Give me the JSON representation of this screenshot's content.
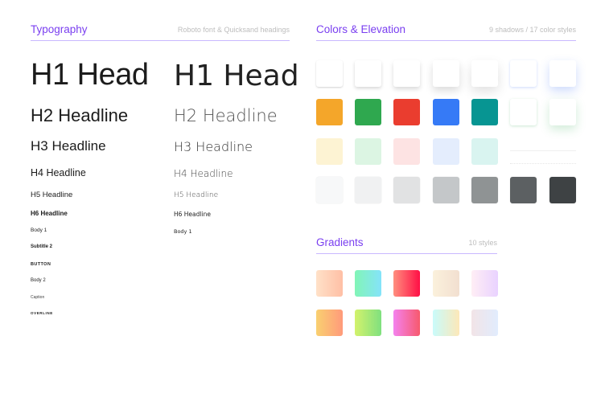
{
  "typography": {
    "title": "Typography",
    "meta": "Roboto font & Quicksand headings",
    "roboto": [
      {
        "style": "h1",
        "label": "H1 Head"
      },
      {
        "style": "h2",
        "label": "H2 Headline"
      },
      {
        "style": "h3",
        "label": "H3 Headline"
      },
      {
        "style": "h4",
        "label": "H4 Headline"
      },
      {
        "style": "h5",
        "label": "H5 Headline"
      },
      {
        "style": "h6",
        "label": "H6 Headline"
      },
      {
        "style": "body1",
        "label": "Body 1"
      },
      {
        "style": "sub2",
        "label": "Subtitle 2"
      },
      {
        "style": "button",
        "label": "BUTTON"
      },
      {
        "style": "body2",
        "label": "Body 2"
      },
      {
        "style": "caption",
        "label": "Caption"
      },
      {
        "style": "overline",
        "label": "OVERLINE"
      }
    ],
    "quicksand": [
      {
        "style": "h1",
        "label": "H1 Head"
      },
      {
        "style": "h2",
        "label": "H2 Headline"
      },
      {
        "style": "h3",
        "label": "H3 Headline"
      },
      {
        "style": "h4",
        "label": "H4 Headline"
      },
      {
        "style": "h5",
        "label": "H5 Headline"
      },
      {
        "style": "h6",
        "label": "H6 Headline"
      },
      {
        "style": "body1",
        "label": "Body 1"
      }
    ]
  },
  "colors": {
    "title": "Colors & Elevation",
    "meta": "9 shadows / 17 color styles",
    "shadows": [
      {
        "name": "elevation-1"
      },
      {
        "name": "elevation-2"
      },
      {
        "name": "elevation-3"
      },
      {
        "name": "elevation-4"
      },
      {
        "name": "elevation-5"
      },
      {
        "name": "elevation-blue-1",
        "tint": "#3b6ef5"
      },
      {
        "name": "elevation-blue-2",
        "tint": "#3b6ef5"
      },
      {
        "name": "elevation-green-1",
        "tint": "#34a853"
      },
      {
        "name": "elevation-green-2",
        "tint": "#34a853"
      }
    ],
    "primary": [
      "#f4a62a",
      "#2fa84f",
      "#ea3d2f",
      "#367af6",
      "#079592"
    ],
    "light": [
      "#fdf3d3",
      "#dcf5e3",
      "#fde3e3",
      "#e4edfd",
      "#d9f4f0"
    ],
    "grays": [
      "#f7f8f9",
      "#f0f1f2",
      "#e1e2e3",
      "#c4c7c9",
      "#8f9394",
      "#5c6062",
      "#3e4244"
    ]
  },
  "gradients": {
    "title": "Gradients",
    "meta": "10 styles",
    "items": [
      {
        "from": "#ffe1c8",
        "to": "#ffbfa5"
      },
      {
        "from": "#82f5b6",
        "to": "#84e3fa"
      },
      {
        "from": "#ff8f7f",
        "to": "#ff0f45"
      },
      {
        "from": "#fbf1dc",
        "to": "#f2dfd0"
      },
      {
        "from": "#ffeef5",
        "to": "#e9d2ff"
      },
      {
        "from": "#f9d070",
        "to": "#ff9a7b"
      },
      {
        "from": "#d3f26c",
        "to": "#7fe07f"
      },
      {
        "from": "#f482ee",
        "to": "#f7596d"
      },
      {
        "from": "#c9fbfb",
        "to": "#fde8b8"
      },
      {
        "from": "#f2e4e7",
        "to": "#e1ecfd"
      }
    ]
  }
}
